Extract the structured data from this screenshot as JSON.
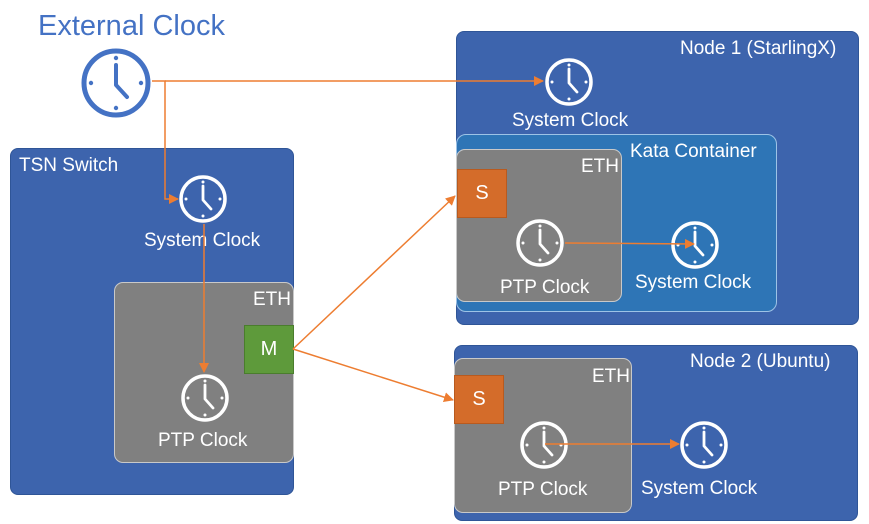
{
  "external": {
    "title": "External Clock",
    "icon": "clock-icon"
  },
  "tsn_switch": {
    "title": "TSN Switch",
    "system_clock_label": "System Clock",
    "eth": {
      "label": "ETH",
      "port_label": "M",
      "ptp_clock_label": "PTP Clock"
    }
  },
  "node1": {
    "title": "Node 1 (StarlingX)",
    "system_clock_label": "System Clock",
    "kata": {
      "title": "Kata Container",
      "system_clock_label": "System Clock",
      "eth": {
        "label": "ETH",
        "port_label": "S",
        "ptp_clock_label": "PTP Clock"
      }
    }
  },
  "node2": {
    "title": "Node 2 (Ubuntu)",
    "system_clock_label": "System Clock",
    "eth": {
      "label": "ETH",
      "port_label": "S",
      "ptp_clock_label": "PTP Clock"
    }
  },
  "colors": {
    "node_blue": "#3d64ad",
    "kata_blue": "#2e75b6",
    "eth_gray": "#808080",
    "master_green": "#5e9a3b",
    "slave_orange": "#d46c2a",
    "arrow_orange": "#ed7d31",
    "title_blue": "#4472c4"
  },
  "connections": [
    {
      "from": "external-clock",
      "to": "tsn-system-clock"
    },
    {
      "from": "external-clock",
      "to": "node1-system-clock"
    },
    {
      "from": "tsn-system-clock",
      "to": "tsn-ptp-clock"
    },
    {
      "from": "tsn-master-port",
      "to": "node1-slave-port"
    },
    {
      "from": "tsn-master-port",
      "to": "node2-slave-port"
    },
    {
      "from": "node1-ptp-clock",
      "to": "kata-system-clock"
    },
    {
      "from": "node2-ptp-clock",
      "to": "node2-system-clock"
    }
  ]
}
